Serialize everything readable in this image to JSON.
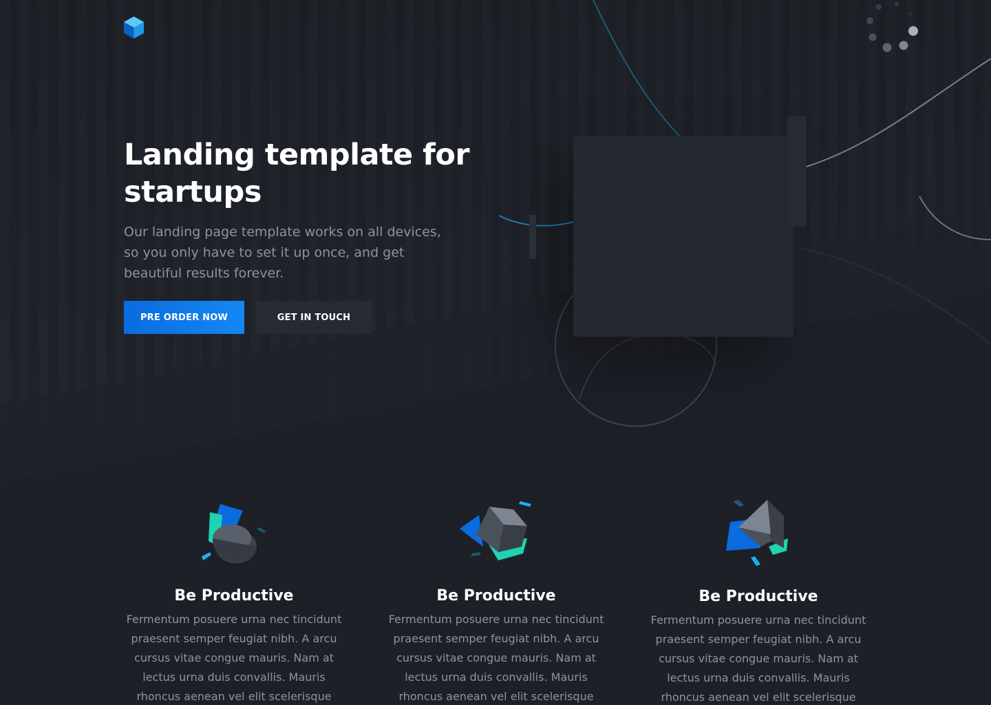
{
  "colors": {
    "background": "#1d2026",
    "primary_button": "#1487f2",
    "secondary_button": "#262a33",
    "text_muted": "#8a94a7",
    "accent_teal": "#1ed3b0",
    "accent_blue": "#0a6cdf"
  },
  "header": {
    "logo_icon": "cube-logo-icon",
    "loader_icon": "dots-loader-icon"
  },
  "hero": {
    "title": "Landing template for startups",
    "paragraph": "Our landing page template works on all devices, so you only have to set it up once, and get beautiful results forever.",
    "primary_button": "PRE ORDER NOW",
    "secondary_button": "GET IN TOUCH"
  },
  "features": [
    {
      "icon": "cylinder-shape-icon",
      "title": "Be Productive",
      "text": "Fermentum posuere urna nec tincidunt praesent semper feugiat nibh. A arcu cursus vitae congue mauris. Nam at lectus urna duis convallis. Mauris rhoncus aenean vel elit scelerisque"
    },
    {
      "icon": "cube-shape-icon",
      "title": "Be Productive",
      "text": "Fermentum posuere urna nec tincidunt praesent semper feugiat nibh. A arcu cursus vitae congue mauris. Nam at lectus urna duis convallis. Mauris rhoncus aenean vel elit scelerisque"
    },
    {
      "icon": "pyramid-shape-icon",
      "title": "Be Productive",
      "text": "Fermentum posuere urna nec tincidunt praesent semper feugiat nibh. A arcu cursus vitae congue mauris. Nam at lectus urna duis convallis. Mauris rhoncus aenean vel elit scelerisque"
    }
  ]
}
